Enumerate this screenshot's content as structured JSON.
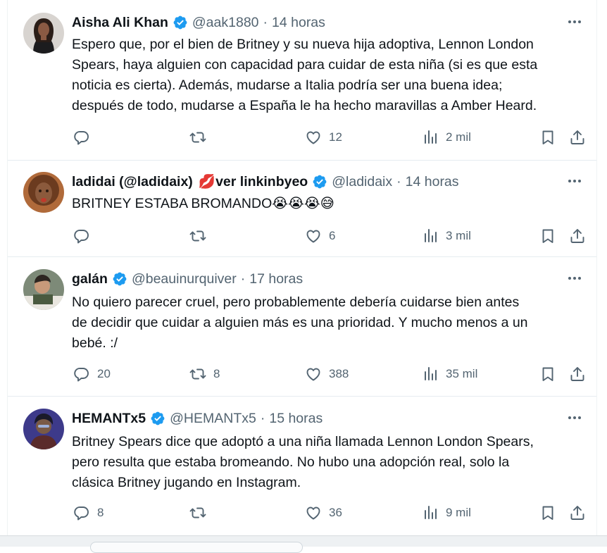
{
  "tweets": [
    {
      "name": "Aisha Ali Khan",
      "verified": true,
      "handle": "@aak1880",
      "separator": "·",
      "time": "14 horas",
      "text_lines": [
        "Espero que, por el bien de Britney y su nueva hija adoptiva, Lennon London",
        "Spears, haya alguien con capacidad para cuidar de esta niña (si es que esta",
        "noticia es cierta). Además, mudarse a Italia podría ser una buena idea;",
        "después de todo, mudarse a España le ha hecho maravillas a Amber Heard."
      ],
      "replies": "",
      "retweets": "",
      "likes": "12",
      "views": "2 mil"
    },
    {
      "name": "ladidai (@ladidaix)",
      "name_emoji": "💋",
      "name_suffix": "ver linkinbyeo",
      "verified": true,
      "handle": "@ladidaix",
      "separator": "·",
      "time": "14 horas",
      "text_lines": [
        "BRITNEY ESTABA BROMANDO😭😭😭😅"
      ],
      "replies": "",
      "retweets": "",
      "likes": "6",
      "views": "3 mil"
    },
    {
      "name": "galán",
      "verified": true,
      "handle": "@beauinurquiver",
      "separator": "·",
      "time": "17 horas",
      "text_lines": [
        "No quiero parecer cruel, pero probablemente debería cuidarse bien antes",
        "de decidir que cuidar a alguien más es una prioridad. Y mucho menos a un",
        "bebé. :/"
      ],
      "replies": "20",
      "retweets": "8",
      "likes": "388",
      "views": "35 mil"
    },
    {
      "name": "HEMANTx5",
      "verified": true,
      "handle": "@HEMANTx5",
      "separator": "·",
      "time": "15 horas",
      "text_lines": [
        "Britney Spears dice que adoptó a una niña llamada Lennon London Spears,",
        "pero resulta que estaba bromeando. No hubo una adopción real, solo la",
        "clásica Britney jugando en Instagram."
      ],
      "replies": "8",
      "retweets": "",
      "likes": "36",
      "views": "9 mil"
    }
  ],
  "colors": {
    "text": "#0f1419",
    "muted": "#536471",
    "verified": "#1d9bf0",
    "divider": "#e6ecf0"
  },
  "icons": [
    "verified-badge-icon",
    "more-icon",
    "reply-icon",
    "retweet-icon",
    "like-icon",
    "views-icon",
    "bookmark-icon",
    "share-icon"
  ]
}
